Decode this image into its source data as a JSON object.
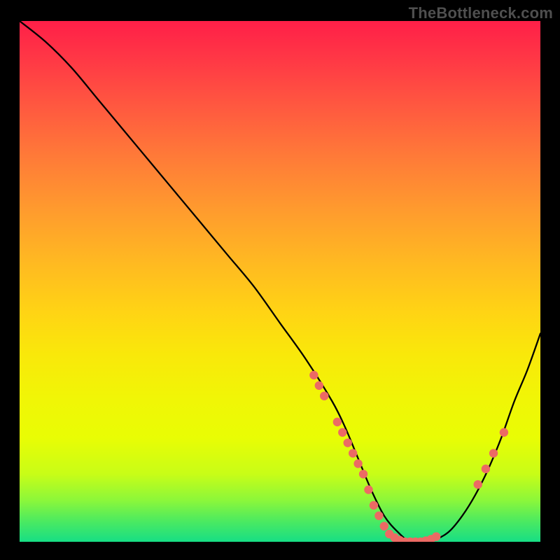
{
  "watermark": "TheBottleneck.com",
  "colors": {
    "background": "#000000",
    "gradient_top": "#ff1f48",
    "gradient_bottom": "#17de85",
    "curve": "#000000",
    "markers": "#ec6a64"
  },
  "chart_data": {
    "type": "line",
    "title": "",
    "xlabel": "",
    "ylabel": "",
    "xlim": [
      0,
      100
    ],
    "ylim": [
      0,
      100
    ],
    "grid": false,
    "legend": false,
    "curve": {
      "x": [
        0,
        5,
        10,
        15,
        20,
        25,
        30,
        35,
        40,
        45,
        50,
        55,
        60,
        62.5,
        65,
        67.5,
        70,
        72.5,
        75,
        77.5,
        80,
        82.5,
        85,
        87.5,
        90,
        92.5,
        95,
        97.5,
        100
      ],
      "y": [
        100,
        96,
        91,
        85,
        79,
        73,
        67,
        61,
        55,
        49,
        42,
        35,
        27,
        22,
        16,
        10,
        5,
        2,
        0,
        0,
        0.5,
        2,
        5,
        9,
        14,
        20,
        27,
        33,
        40
      ]
    },
    "markers": [
      {
        "x": 56.5,
        "y": 32
      },
      {
        "x": 57.5,
        "y": 30
      },
      {
        "x": 58.5,
        "y": 28
      },
      {
        "x": 61,
        "y": 23
      },
      {
        "x": 62,
        "y": 21
      },
      {
        "x": 63,
        "y": 19
      },
      {
        "x": 64,
        "y": 17
      },
      {
        "x": 65,
        "y": 15
      },
      {
        "x": 66,
        "y": 13
      },
      {
        "x": 67,
        "y": 10
      },
      {
        "x": 68,
        "y": 7
      },
      {
        "x": 69,
        "y": 5
      },
      {
        "x": 70,
        "y": 3
      },
      {
        "x": 71,
        "y": 1.5
      },
      {
        "x": 72,
        "y": 0.8
      },
      {
        "x": 73,
        "y": 0.3
      },
      {
        "x": 74,
        "y": 0
      },
      {
        "x": 75,
        "y": 0
      },
      {
        "x": 76,
        "y": 0
      },
      {
        "x": 77,
        "y": 0
      },
      {
        "x": 78,
        "y": 0.2
      },
      {
        "x": 79,
        "y": 0.5
      },
      {
        "x": 80,
        "y": 1
      },
      {
        "x": 88,
        "y": 11
      },
      {
        "x": 89.5,
        "y": 14
      },
      {
        "x": 91,
        "y": 17
      },
      {
        "x": 93,
        "y": 21
      }
    ]
  }
}
